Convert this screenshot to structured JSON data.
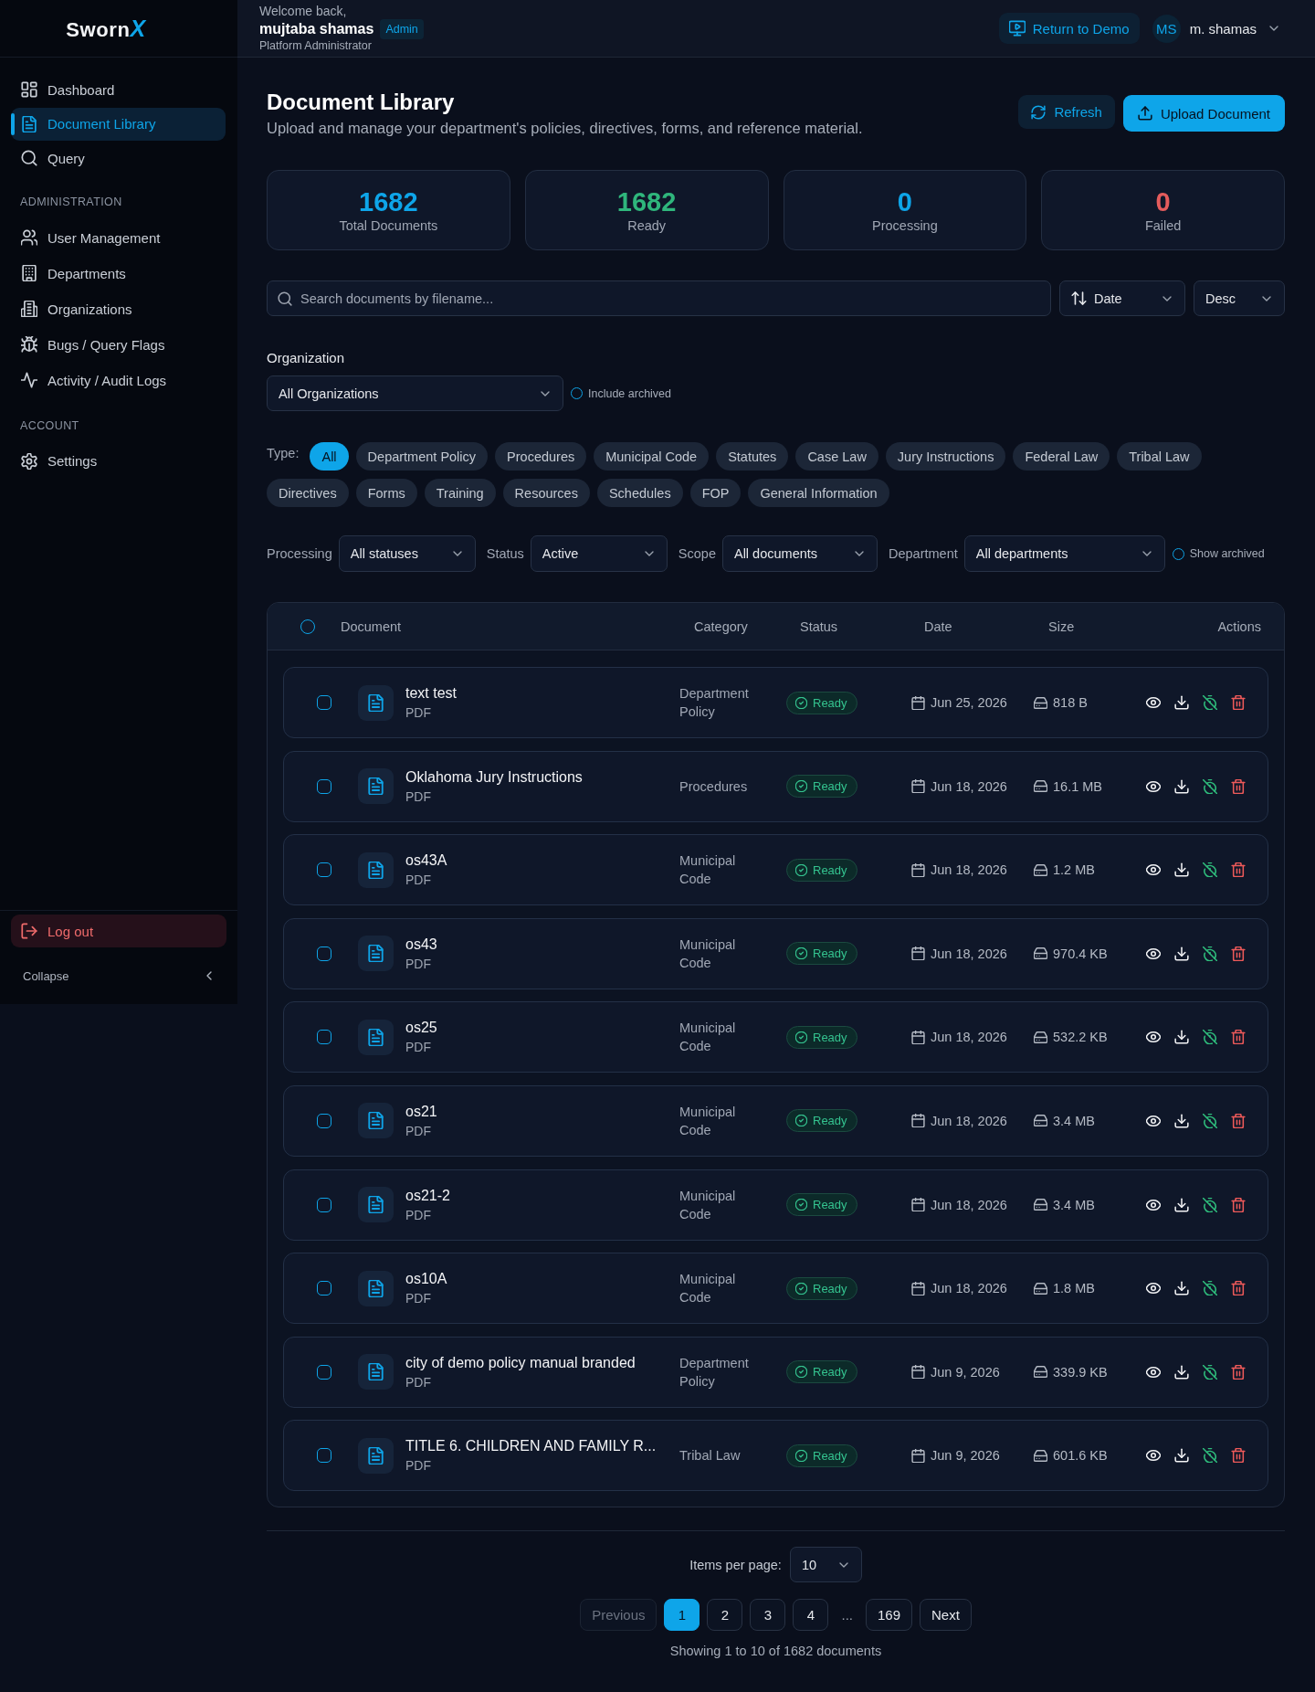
{
  "sidebar": {
    "logo": {
      "text": "Sworn",
      "accent": "X"
    },
    "sections": [
      {
        "items": [
          {
            "label": "Dashboard",
            "selected": false
          },
          {
            "label": "Document Library",
            "selected": true
          },
          {
            "label": "Query",
            "selected": false
          }
        ]
      },
      {
        "heading": "ADMINISTRATION",
        "items": [
          {
            "label": "User Management",
            "selected": false
          },
          {
            "label": "Departments",
            "selected": false
          },
          {
            "label": "Organizations",
            "selected": false
          },
          {
            "label": "Bugs / Query Flags",
            "selected": false
          },
          {
            "label": "Activity / Audit Logs",
            "selected": false
          }
        ]
      },
      {
        "heading": "ACCOUNT",
        "items": [
          {
            "label": "Settings",
            "selected": false
          }
        ]
      }
    ],
    "logout": "Log out",
    "collapse": "Collapse"
  },
  "header": {
    "greeting": "Welcome back,",
    "user_name": "mujtaba shamas",
    "role_badge": "Admin",
    "role_title": "Platform Administrator",
    "return_button": "Return to Demo",
    "avatar_initials": "MS",
    "account_name": "m. shamas"
  },
  "page": {
    "title": "Document Library",
    "subtitle": "Upload and manage your department's policies, directives, forms, and reference material.",
    "refresh_button": "Refresh",
    "upload_button": "Upload Document"
  },
  "stats": [
    {
      "value": "1682",
      "label": "Total Documents",
      "color": "#0ea5e9"
    },
    {
      "value": "1682",
      "label": "Ready",
      "color": "#2fb67c"
    },
    {
      "value": "0",
      "label": "Processing",
      "color": "#0ea5e9"
    },
    {
      "value": "0",
      "label": "Failed",
      "color": "#e45c5c"
    }
  ],
  "search": {
    "placeholder": "Search documents by filename..."
  },
  "sort": {
    "field": "Date",
    "order": "Desc"
  },
  "organization": {
    "label": "Organization",
    "value": "All Organizations",
    "include_archived": {
      "label": "Include archived",
      "checked": false
    }
  },
  "type_filter": {
    "label": "Type:",
    "chips": [
      {
        "label": "All",
        "selected": true
      },
      {
        "label": "Department Policy",
        "selected": false
      },
      {
        "label": "Procedures",
        "selected": false
      },
      {
        "label": "Municipal Code",
        "selected": false
      },
      {
        "label": "Statutes",
        "selected": false
      },
      {
        "label": "Case Law",
        "selected": false
      },
      {
        "label": "Jury Instructions",
        "selected": false
      },
      {
        "label": "Federal Law",
        "selected": false
      },
      {
        "label": "Tribal Law",
        "selected": false
      },
      {
        "label": "Directives",
        "selected": false
      },
      {
        "label": "Forms",
        "selected": false
      },
      {
        "label": "Training",
        "selected": false
      },
      {
        "label": "Resources",
        "selected": false
      },
      {
        "label": "Schedules",
        "selected": false
      },
      {
        "label": "FOP",
        "selected": false
      },
      {
        "label": "General Information",
        "selected": false
      }
    ]
  },
  "filters": [
    {
      "label": "Processing",
      "value": "All statuses"
    },
    {
      "label": "Status",
      "value": "Active"
    },
    {
      "label": "Scope",
      "value": "All documents"
    },
    {
      "label": "Department",
      "value": "All departments"
    }
  ],
  "show_archived": {
    "label": "Show archived",
    "checked": false
  },
  "table": {
    "select_all": {
      "checked": false
    },
    "columns": [
      "Document",
      "Category",
      "Status",
      "Date",
      "Size",
      "Actions"
    ],
    "rows": [
      {
        "name": "text test",
        "type": "PDF",
        "category": "Department Policy",
        "status": "Ready",
        "date": "Jun 25, 2026",
        "size": "818 B",
        "checked": false
      },
      {
        "name": "Oklahoma Jury Instructions",
        "type": "PDF",
        "category": "Procedures",
        "status": "Ready",
        "date": "Jun 18, 2026",
        "size": "16.1 MB",
        "checked": false
      },
      {
        "name": "os43A",
        "type": "PDF",
        "category": "Municipal Code",
        "status": "Ready",
        "date": "Jun 18, 2026",
        "size": "1.2 MB",
        "checked": false
      },
      {
        "name": "os43",
        "type": "PDF",
        "category": "Municipal Code",
        "status": "Ready",
        "date": "Jun 18, 2026",
        "size": "970.4 KB",
        "checked": false
      },
      {
        "name": "os25",
        "type": "PDF",
        "category": "Municipal Code",
        "status": "Ready",
        "date": "Jun 18, 2026",
        "size": "532.2 KB",
        "checked": false
      },
      {
        "name": "os21",
        "type": "PDF",
        "category": "Municipal Code",
        "status": "Ready",
        "date": "Jun 18, 2026",
        "size": "3.4 MB",
        "checked": false
      },
      {
        "name": "os21-2",
        "type": "PDF",
        "category": "Municipal Code",
        "status": "Ready",
        "date": "Jun 18, 2026",
        "size": "3.4 MB",
        "checked": false
      },
      {
        "name": "os10A",
        "type": "PDF",
        "category": "Municipal Code",
        "status": "Ready",
        "date": "Jun 18, 2026",
        "size": "1.8 MB",
        "checked": false
      },
      {
        "name": "city of demo policy manual branded",
        "type": "PDF",
        "category": "Department Policy",
        "status": "Ready",
        "date": "Jun 9, 2026",
        "size": "339.9 KB",
        "checked": false
      },
      {
        "name": "TITLE 6. CHILDREN AND FAMILY R...",
        "type": "PDF",
        "category": "Tribal Law",
        "status": "Ready",
        "date": "Jun 9, 2026",
        "size": "601.6 KB",
        "checked": false
      }
    ]
  },
  "pagination": {
    "per_page_label": "Items per page:",
    "per_page": "10",
    "previous": {
      "label": "Previous",
      "disabled": true
    },
    "pages": [
      {
        "kind": "page",
        "label": "1",
        "selected": true
      },
      {
        "kind": "page",
        "label": "2",
        "selected": false
      },
      {
        "kind": "page",
        "label": "3",
        "selected": false
      },
      {
        "kind": "page",
        "label": "4",
        "selected": false
      },
      {
        "kind": "ellipsis",
        "label": "..."
      },
      {
        "kind": "page",
        "label": "169",
        "selected": false
      }
    ],
    "next": {
      "label": "Next",
      "disabled": false
    },
    "summary": "Showing 1 to 10 of 1682 documents"
  }
}
